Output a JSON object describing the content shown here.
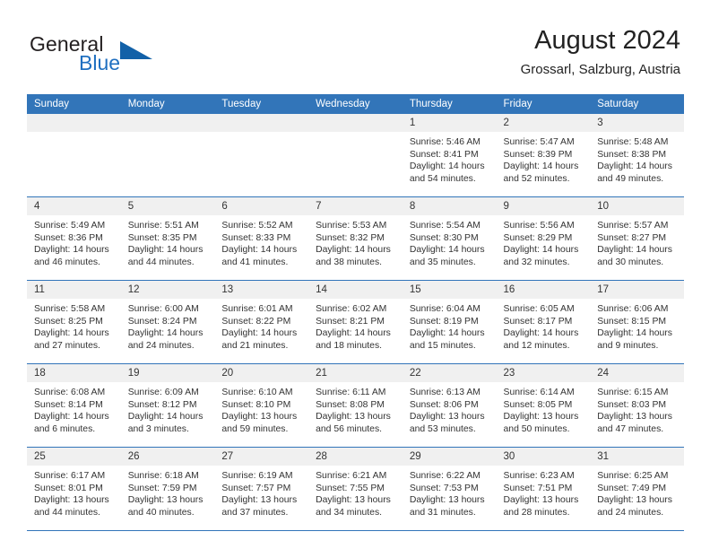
{
  "brand": {
    "name_part1": "General",
    "name_part2": "Blue",
    "accent_color": "#1f6fc0",
    "triangle_color": "#1261a8"
  },
  "header": {
    "title": "August 2024",
    "location": "Grossarl, Salzburg, Austria"
  },
  "calendar": {
    "header_background": "#3275b9",
    "daynum_background": "#f0f0f0",
    "weekday_headers": [
      "Sunday",
      "Monday",
      "Tuesday",
      "Wednesday",
      "Thursday",
      "Friday",
      "Saturday"
    ],
    "weeks": [
      [
        {
          "day": "",
          "empty": true
        },
        {
          "day": "",
          "empty": true
        },
        {
          "day": "",
          "empty": true
        },
        {
          "day": "",
          "empty": true
        },
        {
          "day": "1",
          "sunrise": "Sunrise: 5:46 AM",
          "sunset": "Sunset: 8:41 PM",
          "daylight": "Daylight: 14 hours and 54 minutes."
        },
        {
          "day": "2",
          "sunrise": "Sunrise: 5:47 AM",
          "sunset": "Sunset: 8:39 PM",
          "daylight": "Daylight: 14 hours and 52 minutes."
        },
        {
          "day": "3",
          "sunrise": "Sunrise: 5:48 AM",
          "sunset": "Sunset: 8:38 PM",
          "daylight": "Daylight: 14 hours and 49 minutes."
        }
      ],
      [
        {
          "day": "4",
          "sunrise": "Sunrise: 5:49 AM",
          "sunset": "Sunset: 8:36 PM",
          "daylight": "Daylight: 14 hours and 46 minutes."
        },
        {
          "day": "5",
          "sunrise": "Sunrise: 5:51 AM",
          "sunset": "Sunset: 8:35 PM",
          "daylight": "Daylight: 14 hours and 44 minutes."
        },
        {
          "day": "6",
          "sunrise": "Sunrise: 5:52 AM",
          "sunset": "Sunset: 8:33 PM",
          "daylight": "Daylight: 14 hours and 41 minutes."
        },
        {
          "day": "7",
          "sunrise": "Sunrise: 5:53 AM",
          "sunset": "Sunset: 8:32 PM",
          "daylight": "Daylight: 14 hours and 38 minutes."
        },
        {
          "day": "8",
          "sunrise": "Sunrise: 5:54 AM",
          "sunset": "Sunset: 8:30 PM",
          "daylight": "Daylight: 14 hours and 35 minutes."
        },
        {
          "day": "9",
          "sunrise": "Sunrise: 5:56 AM",
          "sunset": "Sunset: 8:29 PM",
          "daylight": "Daylight: 14 hours and 32 minutes."
        },
        {
          "day": "10",
          "sunrise": "Sunrise: 5:57 AM",
          "sunset": "Sunset: 8:27 PM",
          "daylight": "Daylight: 14 hours and 30 minutes."
        }
      ],
      [
        {
          "day": "11",
          "sunrise": "Sunrise: 5:58 AM",
          "sunset": "Sunset: 8:25 PM",
          "daylight": "Daylight: 14 hours and 27 minutes."
        },
        {
          "day": "12",
          "sunrise": "Sunrise: 6:00 AM",
          "sunset": "Sunset: 8:24 PM",
          "daylight": "Daylight: 14 hours and 24 minutes."
        },
        {
          "day": "13",
          "sunrise": "Sunrise: 6:01 AM",
          "sunset": "Sunset: 8:22 PM",
          "daylight": "Daylight: 14 hours and 21 minutes."
        },
        {
          "day": "14",
          "sunrise": "Sunrise: 6:02 AM",
          "sunset": "Sunset: 8:21 PM",
          "daylight": "Daylight: 14 hours and 18 minutes."
        },
        {
          "day": "15",
          "sunrise": "Sunrise: 6:04 AM",
          "sunset": "Sunset: 8:19 PM",
          "daylight": "Daylight: 14 hours and 15 minutes."
        },
        {
          "day": "16",
          "sunrise": "Sunrise: 6:05 AM",
          "sunset": "Sunset: 8:17 PM",
          "daylight": "Daylight: 14 hours and 12 minutes."
        },
        {
          "day": "17",
          "sunrise": "Sunrise: 6:06 AM",
          "sunset": "Sunset: 8:15 PM",
          "daylight": "Daylight: 14 hours and 9 minutes."
        }
      ],
      [
        {
          "day": "18",
          "sunrise": "Sunrise: 6:08 AM",
          "sunset": "Sunset: 8:14 PM",
          "daylight": "Daylight: 14 hours and 6 minutes."
        },
        {
          "day": "19",
          "sunrise": "Sunrise: 6:09 AM",
          "sunset": "Sunset: 8:12 PM",
          "daylight": "Daylight: 14 hours and 3 minutes."
        },
        {
          "day": "20",
          "sunrise": "Sunrise: 6:10 AM",
          "sunset": "Sunset: 8:10 PM",
          "daylight": "Daylight: 13 hours and 59 minutes."
        },
        {
          "day": "21",
          "sunrise": "Sunrise: 6:11 AM",
          "sunset": "Sunset: 8:08 PM",
          "daylight": "Daylight: 13 hours and 56 minutes."
        },
        {
          "day": "22",
          "sunrise": "Sunrise: 6:13 AM",
          "sunset": "Sunset: 8:06 PM",
          "daylight": "Daylight: 13 hours and 53 minutes."
        },
        {
          "day": "23",
          "sunrise": "Sunrise: 6:14 AM",
          "sunset": "Sunset: 8:05 PM",
          "daylight": "Daylight: 13 hours and 50 minutes."
        },
        {
          "day": "24",
          "sunrise": "Sunrise: 6:15 AM",
          "sunset": "Sunset: 8:03 PM",
          "daylight": "Daylight: 13 hours and 47 minutes."
        }
      ],
      [
        {
          "day": "25",
          "sunrise": "Sunrise: 6:17 AM",
          "sunset": "Sunset: 8:01 PM",
          "daylight": "Daylight: 13 hours and 44 minutes."
        },
        {
          "day": "26",
          "sunrise": "Sunrise: 6:18 AM",
          "sunset": "Sunset: 7:59 PM",
          "daylight": "Daylight: 13 hours and 40 minutes."
        },
        {
          "day": "27",
          "sunrise": "Sunrise: 6:19 AM",
          "sunset": "Sunset: 7:57 PM",
          "daylight": "Daylight: 13 hours and 37 minutes."
        },
        {
          "day": "28",
          "sunrise": "Sunrise: 6:21 AM",
          "sunset": "Sunset: 7:55 PM",
          "daylight": "Daylight: 13 hours and 34 minutes."
        },
        {
          "day": "29",
          "sunrise": "Sunrise: 6:22 AM",
          "sunset": "Sunset: 7:53 PM",
          "daylight": "Daylight: 13 hours and 31 minutes."
        },
        {
          "day": "30",
          "sunrise": "Sunrise: 6:23 AM",
          "sunset": "Sunset: 7:51 PM",
          "daylight": "Daylight: 13 hours and 28 minutes."
        },
        {
          "day": "31",
          "sunrise": "Sunrise: 6:25 AM",
          "sunset": "Sunset: 7:49 PM",
          "daylight": "Daylight: 13 hours and 24 minutes."
        }
      ]
    ]
  }
}
